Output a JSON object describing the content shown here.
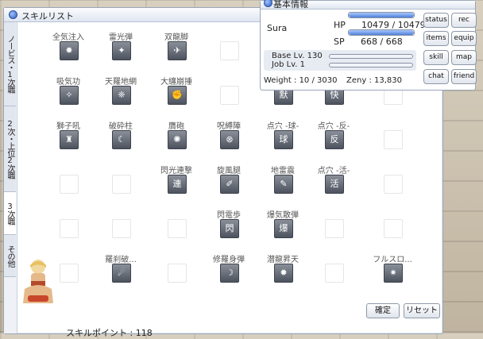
{
  "skill_window": {
    "title": "スキルリスト",
    "tabs": [
      {
        "label": "ノービス・1次職",
        "active": false
      },
      {
        "label": "2次・上位2次職",
        "active": false
      },
      {
        "label": "3次職",
        "active": true
      },
      {
        "label": "その他",
        "active": false
      }
    ],
    "skill_points_label": "スキルポイント : 118",
    "confirm_label": "確定",
    "reset_label": "リセット",
    "rows": [
      {
        "labels": [
          "全気注入",
          "雷光弾",
          "双龍脚",
          "",
          "",
          "",
          ""
        ],
        "icons": [
          "burst",
          "spark",
          "dragon",
          "",
          "",
          "",
          ""
        ]
      },
      {
        "labels": [
          "吸気功",
          "天羅地網",
          "大纏崩捶",
          "",
          "",
          "",
          ""
        ],
        "icons": [
          "breath",
          "net",
          "fist",
          "",
          "默",
          "快",
          ""
        ]
      },
      {
        "labels": [
          "獅子吼",
          "破砕柱",
          "贋砲",
          "呪縛陣",
          "点穴 -球-",
          "点穴 -反-",
          ""
        ],
        "icons": [
          "lion",
          "moon",
          "cannon",
          "circle",
          "球",
          "反",
          ""
        ]
      },
      {
        "labels": [
          "",
          "",
          "閃光連撃",
          "旋風腿",
          "地雷震",
          "点穴 -活-",
          ""
        ],
        "icons": [
          "",
          "",
          "連",
          "kick",
          "quake",
          "活",
          ""
        ]
      },
      {
        "labels": [
          "",
          "",
          "",
          "閃電歩",
          "爆気散弾",
          "",
          ""
        ],
        "icons": [
          "",
          "",
          "",
          "閃",
          "爆",
          "",
          ""
        ]
      },
      {
        "labels": [
          "",
          "羅刹破...",
          "",
          "修羅身弾",
          "潜龍昇天",
          "",
          "フルスロ..."
        ],
        "icons": [
          "",
          "rakshasa",
          "",
          "shura",
          "rise",
          "",
          "full"
        ]
      }
    ]
  },
  "basic_info": {
    "title": "基本情報",
    "name": "Sura",
    "hp_label": "HP",
    "hp_value": "10479 / 10479",
    "sp_label": "SP",
    "sp_value": "668 / 668",
    "hp_fill": 1.0,
    "sp_fill": 1.0,
    "base_lv": "Base Lv. 130",
    "job_lv": "Job Lv. 1",
    "weight": "Weight : 10 / 3030",
    "zeny": "Zeny : 13,830",
    "buttons": [
      "status",
      "rec",
      "items",
      "equip",
      "skill",
      "map",
      "chat",
      "friend"
    ]
  }
}
